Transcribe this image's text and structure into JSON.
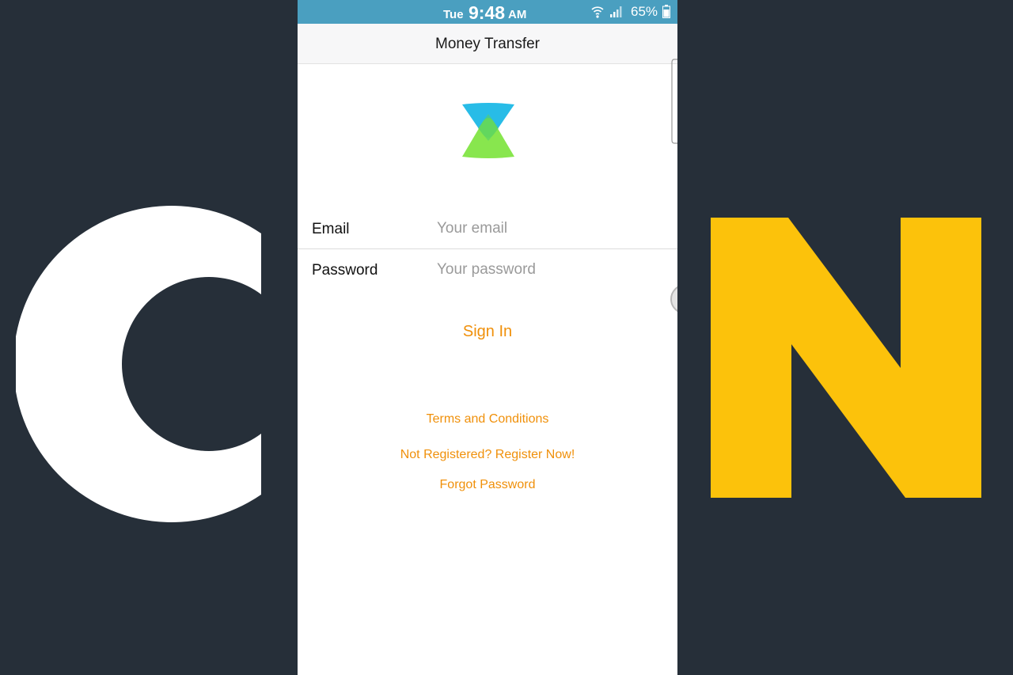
{
  "background": {
    "letter_left": "C",
    "letter_right": "N",
    "color_dark": "#262f39",
    "color_left": "#ffffff",
    "color_right": "#fcc20b"
  },
  "status_bar": {
    "day": "Tue",
    "time": "9:48",
    "ampm": "AM",
    "battery": "65%",
    "icons": [
      "wifi-icon",
      "signal-icon",
      "battery-icon"
    ],
    "color": "#4a9fc0"
  },
  "header": {
    "title": "Money Transfer"
  },
  "logo": {
    "icon": "xender-logo-icon",
    "colors": [
      "#1cb8e6",
      "#7ee43f"
    ]
  },
  "form": {
    "email": {
      "label": "Email",
      "placeholder": "Your email",
      "value": ""
    },
    "password": {
      "label": "Password",
      "placeholder": "Your password",
      "value": ""
    }
  },
  "actions": {
    "sign_in": "Sign In",
    "terms": "Terms and Conditions",
    "register": "Not Registered? Register Now!",
    "forgot": "Forgot Password",
    "accent": "#f0900a"
  }
}
